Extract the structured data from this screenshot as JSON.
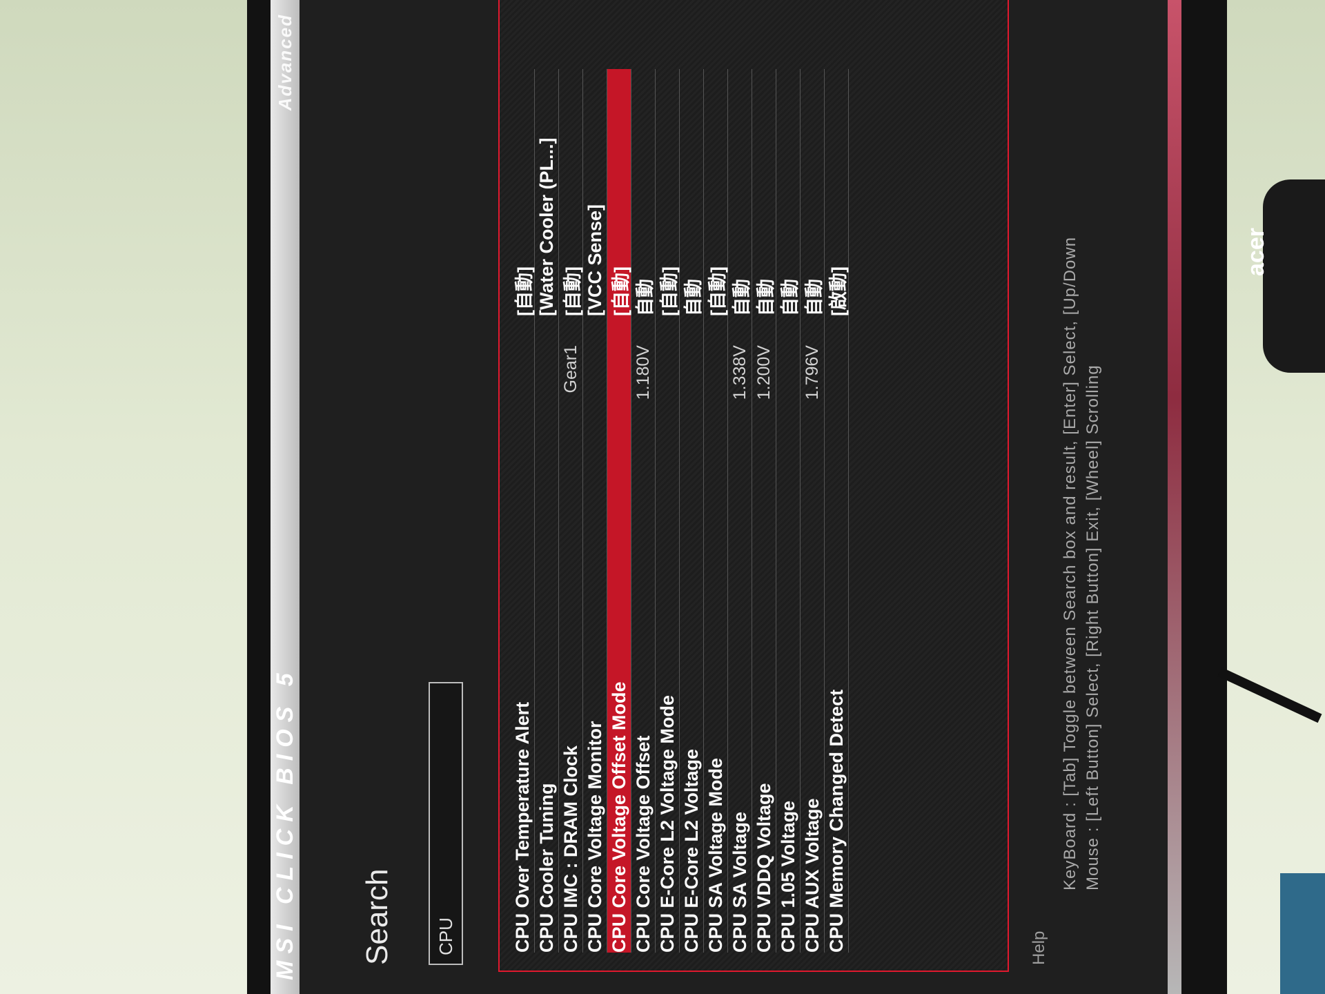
{
  "header": {
    "brand": "MSI CLICK BIOS 5",
    "tab": "Advanced"
  },
  "search": {
    "title": "Search",
    "query": "CPU"
  },
  "results": [
    {
      "label": "CPU Over Temperature Alert",
      "info": "",
      "value": "[自動]"
    },
    {
      "label": "CPU Cooler Tuning",
      "info": "",
      "value": "[Water Cooler (PL...]"
    },
    {
      "label": "CPU IMC : DRAM Clock",
      "info": "Gear1",
      "value": "[自動]"
    },
    {
      "label": "CPU Core Voltage Monitor",
      "info": "",
      "value": "[VCC Sense]"
    },
    {
      "label": "CPU Core Voltage Offset Mode",
      "info": "",
      "value": "[自動]",
      "selected": true
    },
    {
      "label": "CPU Core Voltage Offset",
      "info": "1.180V",
      "value": "自動"
    },
    {
      "label": "CPU E-Core L2 Voltage Mode",
      "info": "",
      "value": "[自動]"
    },
    {
      "label": "CPU E-Core L2 Voltage",
      "info": "",
      "value": "自動"
    },
    {
      "label": "CPU SA Voltage Mode",
      "info": "",
      "value": "[自動]"
    },
    {
      "label": "CPU SA Voltage",
      "info": "1.338V",
      "value": "自動"
    },
    {
      "label": "CPU VDDQ Voltage",
      "info": "1.200V",
      "value": "自動"
    },
    {
      "label": "CPU 1.05 Voltage",
      "info": "",
      "value": "自動"
    },
    {
      "label": "CPU AUX Voltage",
      "info": "1.796V",
      "value": "自動"
    },
    {
      "label": "CPU Memory Changed Detect",
      "info": "",
      "value": "[啟動]"
    }
  ],
  "help": {
    "title": "Help",
    "keyboard": "KeyBoard :  [Tab] Toggle between Search box and result,  [Enter] Select,  [Up/Down",
    "mouse": "Mouse     :  [Left Button] Select,  [Right Button] Exit,  [Wheel] Scrolling"
  },
  "monitor_logo": "acer",
  "colors": {
    "accent": "#e0192e",
    "selected_bg": "#c51627"
  }
}
